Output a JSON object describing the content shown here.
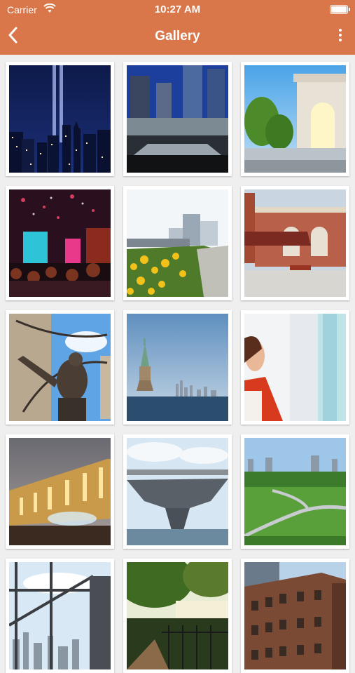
{
  "status_bar": {
    "carrier": "Carrier",
    "time": "10:27 AM"
  },
  "nav": {
    "title": "Gallery"
  },
  "gallery": {
    "items": [
      {
        "subject": "tribute-in-light"
      },
      {
        "subject": "911-memorial"
      },
      {
        "subject": "washington-square-arch"
      },
      {
        "subject": "times-square-crowd"
      },
      {
        "subject": "high-line-flowers"
      },
      {
        "subject": "ellis-island"
      },
      {
        "subject": "atlas-statue"
      },
      {
        "subject": "statue-of-liberty"
      },
      {
        "subject": "woman-in-red"
      },
      {
        "subject": "metropolitan-museum"
      },
      {
        "subject": "intrepid-museum"
      },
      {
        "subject": "park-lawns"
      },
      {
        "subject": "observation-deck"
      },
      {
        "subject": "park-reservoir"
      },
      {
        "subject": "brick-building"
      }
    ]
  },
  "colors": {
    "header": "#d9774a",
    "background": "#efefef"
  }
}
